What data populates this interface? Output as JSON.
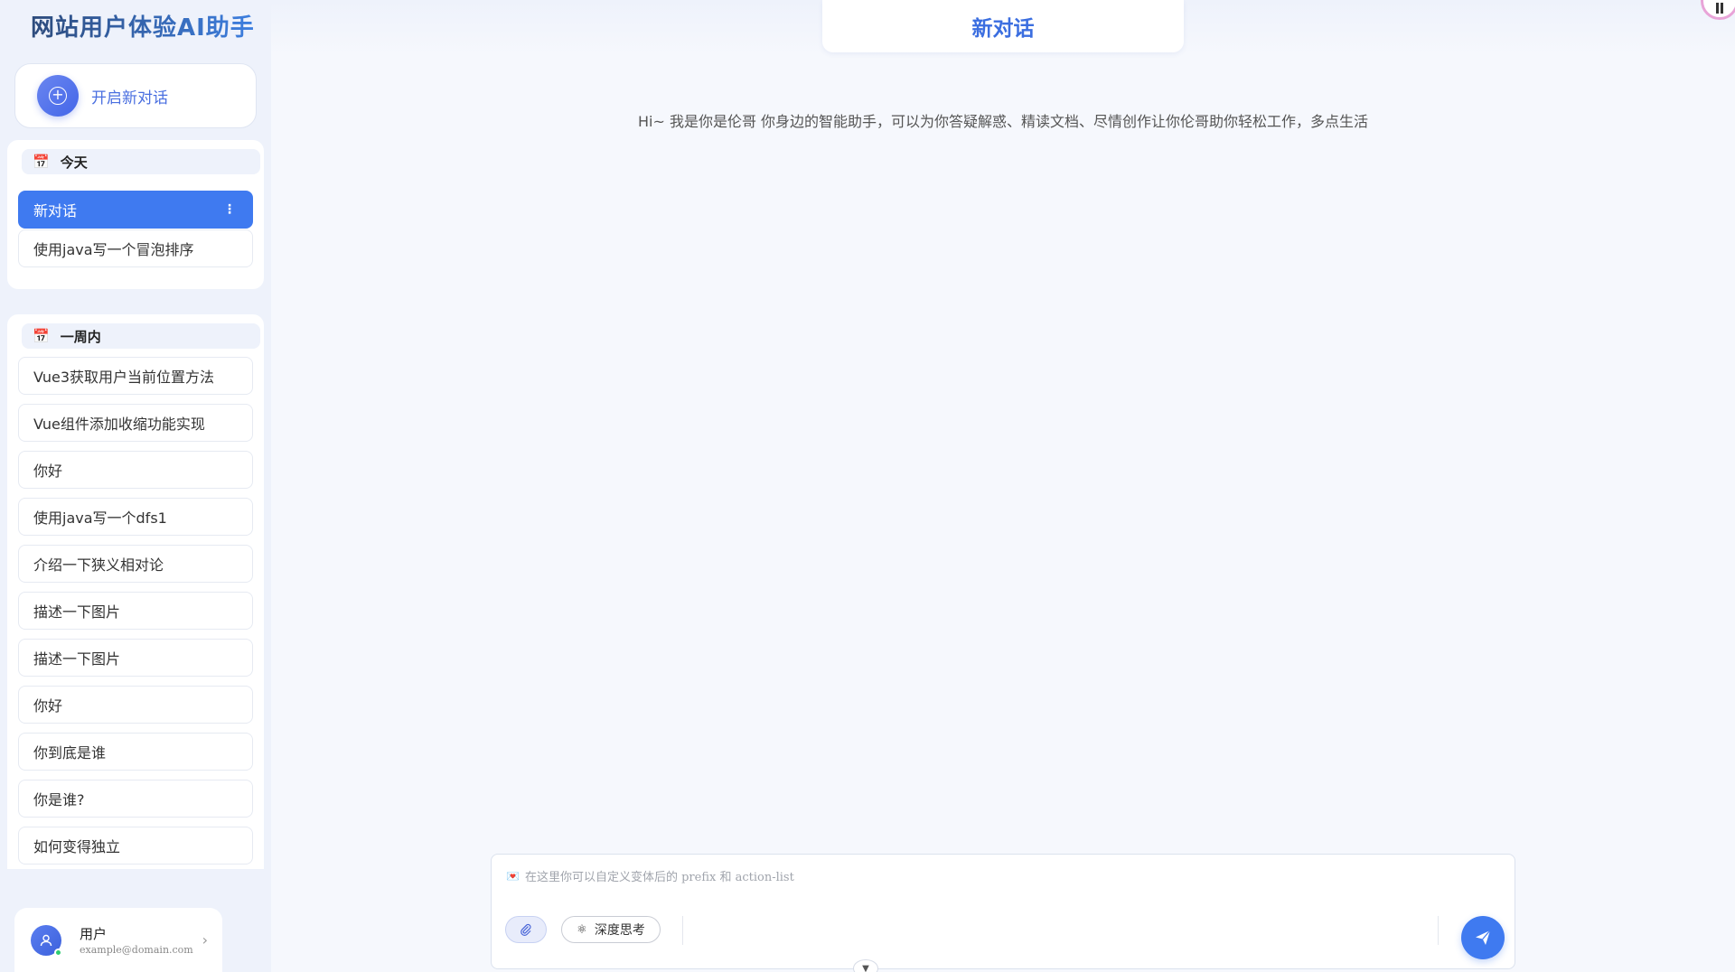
{
  "app": {
    "title": "网站用户体验AI助手"
  },
  "sidebar": {
    "new_chat_label": "开启新对话",
    "new_chat_icon": "plus-circle-icon",
    "today": {
      "header": "今天",
      "icon": "calendar-icon",
      "items": [
        "新对话",
        "使用java写一个冒泡排序"
      ],
      "active_index": 0,
      "more_icon": "more-vertical-icon"
    },
    "week": {
      "header": "一周内",
      "icon": "calendar-icon",
      "items": [
        "Vue3获取用户当前位置方法",
        "Vue组件添加收缩功能实现",
        "你好",
        "使用java写一个dfs1",
        "介绍一下狭义相对论",
        "描述一下图片",
        "描述一下图片",
        "你好",
        "你到底是谁",
        "你是谁?",
        "如何变得独立"
      ]
    },
    "user": {
      "name": "用户",
      "email": "example@domain.com",
      "avatar_icon": "user-icon",
      "status": "online"
    }
  },
  "main": {
    "conversation_title": "新对话",
    "welcome_text": "Hi~ 我是你是伦哥 你身边的智能助手，可以为你答疑解惑、精读文档、尽情创作让你伦哥助你轻松工作，多点生活",
    "composer": {
      "placeholder": "在这里你可以自定义变体后的 prefix 和 action-list",
      "placeholder_icon": "heart-icon",
      "attach_icon": "paperclip-icon",
      "deep_think_label": "深度思考",
      "deep_think_icon": "atom-icon",
      "send_icon": "send-icon"
    }
  },
  "colors": {
    "accent": "#3f7af0",
    "title_gradient_start": "#2d4b7c",
    "title_gradient_end": "#3d7fe0",
    "sidebar_bg": "#eef2fb",
    "main_bg": "#f6f8fd"
  }
}
